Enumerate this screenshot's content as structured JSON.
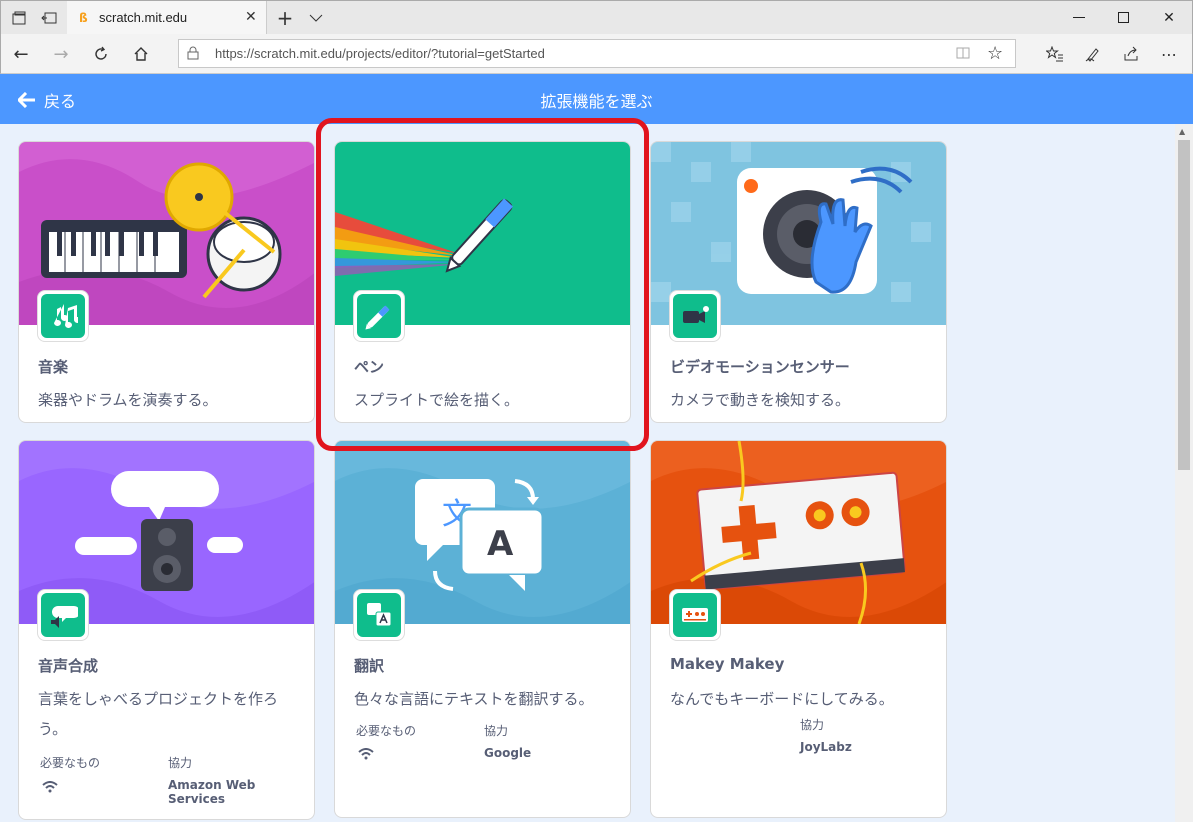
{
  "browser": {
    "tab_title": "scratch.mit.edu",
    "url_host": "https://scratch.mit.edu",
    "url_path": "/projects/editor/?tutorial=getStarted"
  },
  "header": {
    "back_label": "戻る",
    "title": "拡張機能を選ぶ"
  },
  "extensions": [
    {
      "title": "音楽",
      "description": "楽器やドラムを演奏する。"
    },
    {
      "title": "ペン",
      "description": "スプライトで絵を描く。"
    },
    {
      "title": "ビデオモーションセンサー",
      "description": "カメラで動きを検知する。"
    },
    {
      "title": "音声合成",
      "description": "言葉をしゃべるプロジェクトを作ろう。",
      "requires_label": "必要なもの",
      "collab_label": "協力",
      "collaborator": "Amazon Web Services"
    },
    {
      "title": "翻訳",
      "description": "色々な言語にテキストを翻訳する。",
      "requires_label": "必要なもの",
      "collab_label": "協力",
      "collaborator": "Google"
    },
    {
      "title": "Makey Makey",
      "description": "なんでもキーボードにしてみる。",
      "collab_label": "協力",
      "collaborator": "JoyLabz"
    }
  ],
  "translate_art": {
    "left_glyph": "文",
    "right_glyph": "A"
  },
  "colors": {
    "header": "#4c97ff",
    "badge": "#0fbd8c",
    "highlight": "#e1141e",
    "text": "#575e75"
  }
}
